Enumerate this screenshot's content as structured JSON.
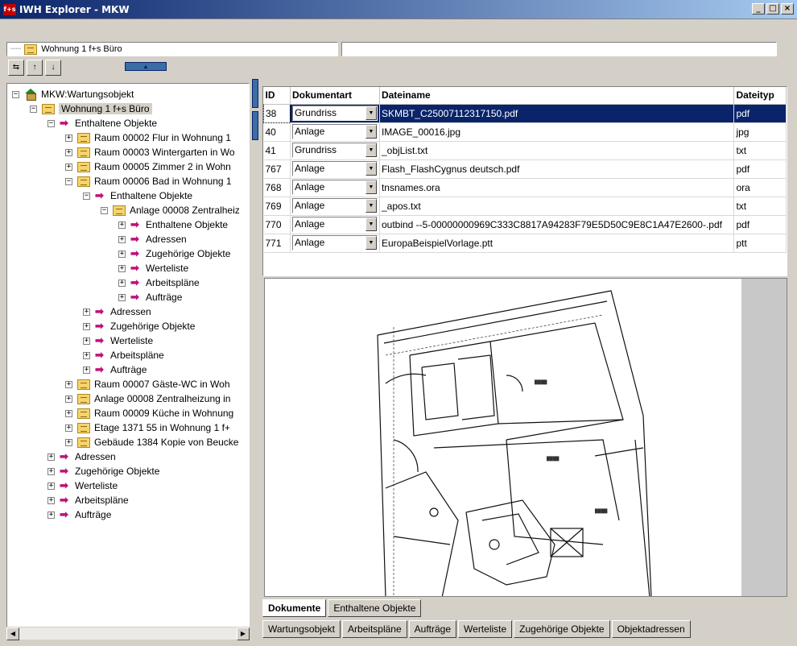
{
  "window": {
    "title": "IWH Explorer - MKW",
    "app_icon": "f+s",
    "minimize": "_",
    "maximize": "□",
    "close": "×"
  },
  "path": {
    "value": "Wohnung 1 f+s Büro",
    "second": ""
  },
  "toolbar": {
    "btn1": "⇆",
    "btn2": "↑",
    "btn3": "↓",
    "collapse": "▲"
  },
  "tree": [
    {
      "label": "MKW:Wartungsobjekt",
      "icon": "house-icon",
      "level": 0,
      "toggle": "−"
    },
    {
      "label": "Wohnung 1 f+s Büro",
      "icon": "folder-icon",
      "level": 1,
      "toggle": "−",
      "selected": true
    },
    {
      "label": "Enthaltene Objekte",
      "icon": "arrow-icon",
      "level": 2,
      "toggle": "−"
    },
    {
      "label": "Raum 00002 Flur  in Wohnung 1",
      "icon": "folder-icon",
      "level": 3,
      "toggle": "+"
    },
    {
      "label": "Raum 00003 Wintergarten  in Wo",
      "icon": "folder-icon",
      "level": 3,
      "toggle": "+"
    },
    {
      "label": "Raum 00005 Zimmer 2  in Wohn",
      "icon": "folder-icon",
      "level": 3,
      "toggle": "+"
    },
    {
      "label": "Raum 00006 Bad  in Wohnung 1",
      "icon": "folder-icon",
      "level": 3,
      "toggle": "−"
    },
    {
      "label": "Enthaltene Objekte",
      "icon": "arrow-icon",
      "level": 4,
      "toggle": "−"
    },
    {
      "label": "Anlage 00008 Zentralheiz",
      "icon": "folder-icon",
      "level": 5,
      "toggle": "−"
    },
    {
      "label": "Enthaltene Objekte",
      "icon": "arrow-icon",
      "level": 6,
      "toggle": "+"
    },
    {
      "label": "Adressen",
      "icon": "arrow-icon",
      "level": 6,
      "toggle": "+"
    },
    {
      "label": "Zugehörige Objekte",
      "icon": "arrow-icon",
      "level": 6,
      "toggle": "+"
    },
    {
      "label": "Werteliste",
      "icon": "arrow-icon",
      "level": 6,
      "toggle": "+"
    },
    {
      "label": "Arbeitspläne",
      "icon": "arrow-icon",
      "level": 6,
      "toggle": "+"
    },
    {
      "label": "Aufträge",
      "icon": "arrow-icon",
      "level": 6,
      "toggle": "+"
    },
    {
      "label": "Adressen",
      "icon": "arrow-icon",
      "level": 4,
      "toggle": "+"
    },
    {
      "label": "Zugehörige Objekte",
      "icon": "arrow-icon",
      "level": 4,
      "toggle": "+"
    },
    {
      "label": "Werteliste",
      "icon": "arrow-icon",
      "level": 4,
      "toggle": "+"
    },
    {
      "label": "Arbeitspläne",
      "icon": "arrow-icon",
      "level": 4,
      "toggle": "+"
    },
    {
      "label": "Aufträge",
      "icon": "arrow-icon",
      "level": 4,
      "toggle": "+"
    },
    {
      "label": "Raum 00007 Gäste-WC  in Woh",
      "icon": "folder-icon",
      "level": 3,
      "toggle": "+"
    },
    {
      "label": "Anlage 00008 Zentralheizung  in",
      "icon": "folder-icon",
      "level": 3,
      "toggle": "+"
    },
    {
      "label": "Raum 00009 Küche  in Wohnung",
      "icon": "folder-icon",
      "level": 3,
      "toggle": "+"
    },
    {
      "label": "Etage 1371 55  in Wohnung 1 f+",
      "icon": "folder-icon",
      "level": 3,
      "toggle": "+"
    },
    {
      "label": "Gebäude 1384 Kopie von Beucke",
      "icon": "folder-icon",
      "level": 3,
      "toggle": "+"
    },
    {
      "label": "Adressen",
      "icon": "arrow-icon",
      "level": 2,
      "toggle": "+"
    },
    {
      "label": "Zugehörige Objekte",
      "icon": "arrow-icon",
      "level": 2,
      "toggle": "+"
    },
    {
      "label": "Werteliste",
      "icon": "arrow-icon",
      "level": 2,
      "toggle": "+"
    },
    {
      "label": "Arbeitspläne",
      "icon": "arrow-icon",
      "level": 2,
      "toggle": "+"
    },
    {
      "label": "Aufträge",
      "icon": "arrow-icon",
      "level": 2,
      "toggle": "+"
    }
  ],
  "grid": {
    "columns": [
      "ID",
      "Dokumentart",
      "Dateiname",
      "Dateityp"
    ],
    "rows": [
      {
        "id": "38",
        "art": "Grundriss",
        "name": "SKMBT_C25007112317150.pdf",
        "typ": "pdf",
        "selected": true
      },
      {
        "id": "40",
        "art": "Anlage",
        "name": "IMAGE_00016.jpg",
        "typ": "jpg"
      },
      {
        "id": "41",
        "art": "Grundriss",
        "name": "_objList.txt",
        "typ": "txt"
      },
      {
        "id": "767",
        "art": "Anlage",
        "name": "Flash_FlashCygnus deutsch.pdf",
        "typ": "pdf"
      },
      {
        "id": "768",
        "art": "Anlage",
        "name": "tnsnames.ora",
        "typ": "ora"
      },
      {
        "id": "769",
        "art": "Anlage",
        "name": "_apos.txt",
        "typ": "txt"
      },
      {
        "id": "770",
        "art": "Anlage",
        "name": "outbind --5-00000000969C333C8817A94283F79E5D50C9E8C1A47E2600-.pdf",
        "typ": "pdf"
      },
      {
        "id": "771",
        "art": "Anlage",
        "name": "EuropaBeispielVorlage.ptt",
        "typ": "ptt"
      }
    ]
  },
  "tabs_top": [
    {
      "label": "Dokumente",
      "active": true
    },
    {
      "label": "Enthaltene Objekte",
      "active": false
    }
  ],
  "tabs_bottom": [
    {
      "label": "Wartungsobjekt"
    },
    {
      "label": "Arbeitspläne"
    },
    {
      "label": "Aufträge"
    },
    {
      "label": "Werteliste"
    },
    {
      "label": "Zugehörige Objekte"
    },
    {
      "label": "Objektadressen"
    }
  ],
  "colors": {
    "titlebar": "#0a246a",
    "selection": "#0a246a",
    "arrow": "#c0107a",
    "folder": "#f7d36c"
  }
}
